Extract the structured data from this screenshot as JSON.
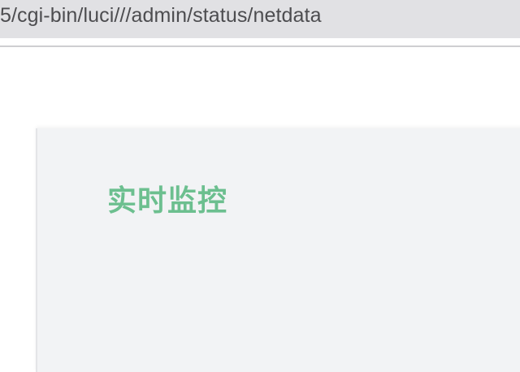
{
  "browser": {
    "url": "5/cgi-bin/luci///admin/status/netdata"
  },
  "page": {
    "title": "实时监控"
  },
  "colors": {
    "accent": "#6cbf8f",
    "panel_bg": "#f2f3f5"
  }
}
